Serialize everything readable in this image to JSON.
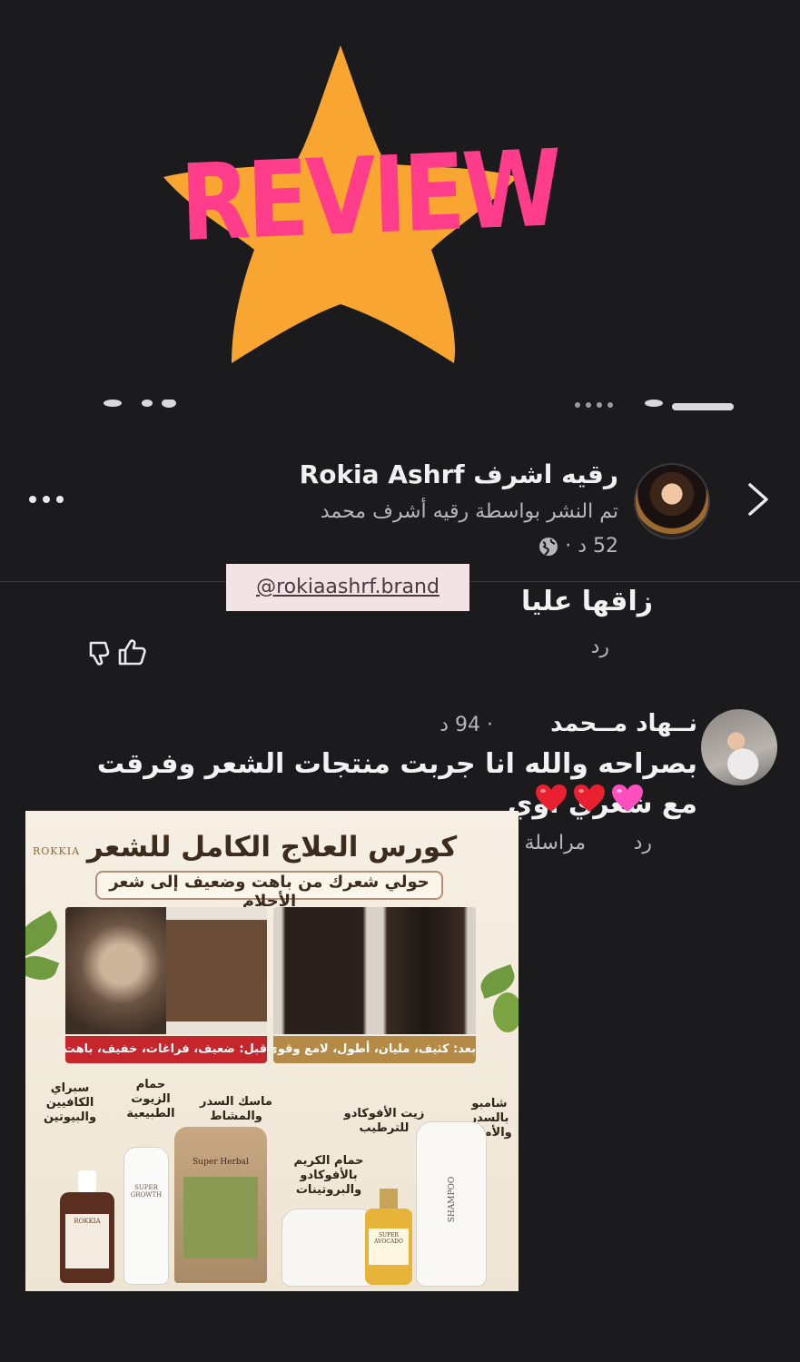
{
  "sticker": {
    "word": "REVIEW",
    "star_color": "#f8a531",
    "text_color": "#ff3d8a"
  },
  "post": {
    "author": "رقيه اشرف Rokia Ashrf",
    "posted_by": "تم النشر بواسطة رقيه أشرف محمد",
    "meta": "52 د ·",
    "handle_sticker": "@rokiaashrf.brand",
    "icons": [
      "chevron-right-icon",
      "globe-icon",
      "more-dots-icon"
    ]
  },
  "comment1": {
    "text": "زاقها عليا",
    "reply": "رد",
    "icons": [
      "like-icon",
      "dislike-icon"
    ]
  },
  "comment2": {
    "name": "نــهاد مــحمد",
    "time": "· 94 د",
    "text": "بصراحه والله انا جربت منتجات الشعر وفرقت مع شعري اوي",
    "reply": "رد",
    "message": "مراسلة",
    "hearts": [
      "pink-heart-icon",
      "red-heart-icon",
      "red-heart-icon"
    ]
  },
  "ad": {
    "brand": "ROKKIA",
    "title": "كورس العلاج الكامل للشعر",
    "subtitle": "حولي شعرك من باهت وضعيف إلى شعر الأحلام",
    "before_caption": "قبل: ضعيف، فراغات، خفيف، باهت",
    "after_caption": "بعد: كثيف، مليان، أطول، لامع وقوي",
    "products": {
      "spray": "سبراي الكافيين والبيوتين",
      "oil_bath": "حمام الزيوت الطبيعية",
      "mask": "ماسك السدر والمشاط",
      "cream_bath": "حمام الكريم بالأفوكادو والبروتينات",
      "avocado_oil": "زيت الأفوكادو للترطيب",
      "shampoo": "شامبو بالسدر والأملاح"
    },
    "product_texts": {
      "spray_bottle": "ROKKIA",
      "foam_bottle": "SUPER GROWTH",
      "mask_pouch": "Super Herbal",
      "avocado_bottle": "SUPER AVOCADO",
      "shampoo_bottle": "SHAMPOO"
    }
  }
}
